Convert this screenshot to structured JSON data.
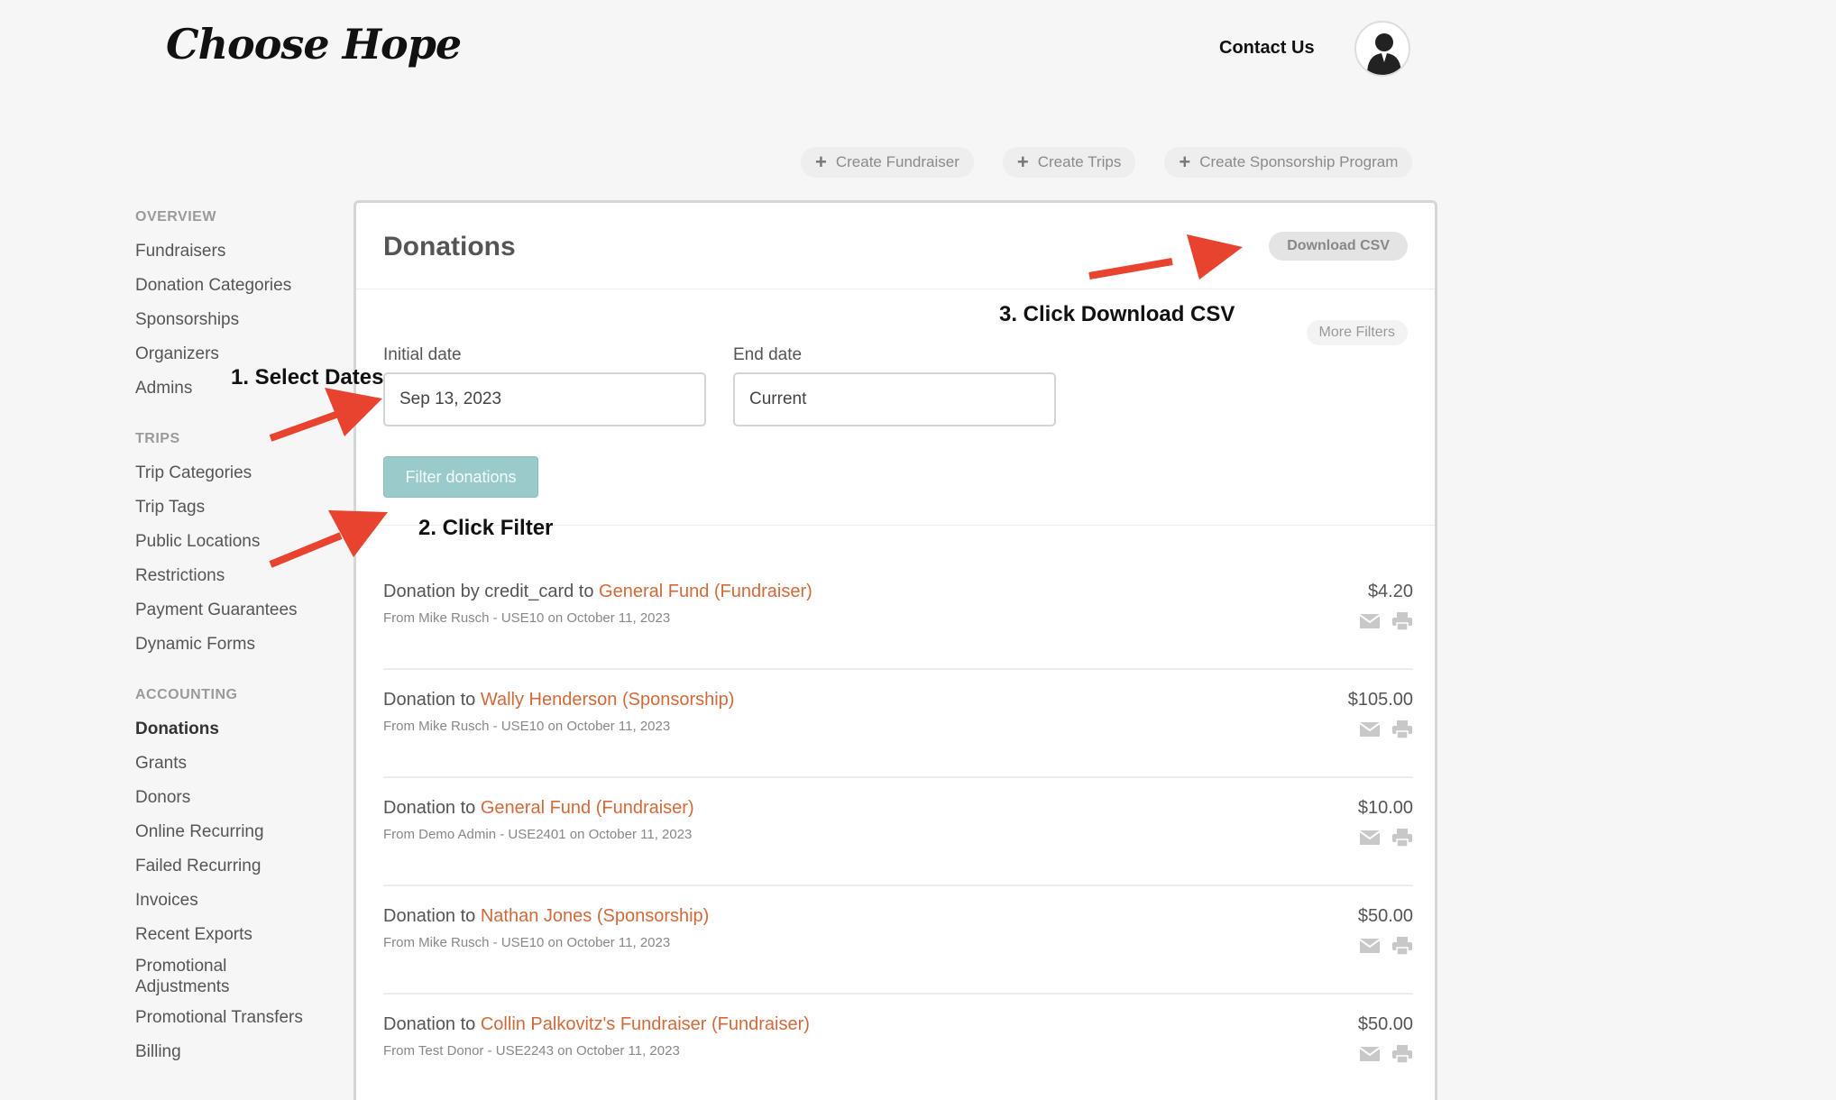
{
  "header": {
    "logo_text": "Choose Hope",
    "contact_label": "Contact Us",
    "avatar_icon": "user-icon"
  },
  "create_actions": [
    {
      "label": "Create Fundraiser",
      "icon": "plus-icon"
    },
    {
      "label": "Create Trips",
      "icon": "plus-icon"
    },
    {
      "label": "Create Sponsorship Program",
      "icon": "plus-icon"
    }
  ],
  "sidebar": {
    "sections": [
      {
        "heading": "OVERVIEW",
        "items": [
          "Fundraisers",
          "Donation Categories",
          "Sponsorships",
          "Organizers",
          "Admins"
        ]
      },
      {
        "heading": "TRIPS",
        "items": [
          "Trip Categories",
          "Trip Tags",
          "Public Locations",
          "Restrictions",
          "Payment Guarantees",
          "Dynamic Forms"
        ]
      },
      {
        "heading": "ACCOUNTING",
        "items": [
          "Donations",
          "Grants",
          "Donors",
          "Online Recurring",
          "Failed Recurring",
          "Invoices",
          "Recent Exports",
          "Promotional Adjustments",
          "Promotional Transfers",
          "Billing"
        ]
      }
    ],
    "active_item": "Donations"
  },
  "panel": {
    "title": "Donations",
    "download_label": "Download CSV",
    "more_filters_label": "More Filters",
    "initial_date_label": "Initial date",
    "initial_date_value": "Sep 13, 2023",
    "end_date_label": "End date",
    "end_date_value": "Current",
    "filter_label": "Filter donations"
  },
  "donations": [
    {
      "prefix": "Donation by credit_card to ",
      "link": "General Fund (Fundraiser)",
      "meta": "From Mike Rusch - USE10 on October 11, 2023",
      "amount": "$4.20"
    },
    {
      "prefix": "Donation to ",
      "link": "Wally Henderson (Sponsorship)",
      "meta": "From Mike Rusch - USE10 on October 11, 2023",
      "amount": "$105.00"
    },
    {
      "prefix": "Donation to ",
      "link": "General Fund (Fundraiser)",
      "meta": "From Demo Admin - USE2401 on October 11, 2023",
      "amount": "$10.00"
    },
    {
      "prefix": "Donation to ",
      "link": "Nathan Jones (Sponsorship)",
      "meta": "From Mike Rusch - USE10 on October 11, 2023",
      "amount": "$50.00"
    },
    {
      "prefix": "Donation to ",
      "link": "Collin Palkovitz's Fundraiser (Fundraiser)",
      "meta": "From Test Donor - USE2243 on October 11, 2023",
      "amount": "$50.00"
    }
  ],
  "annotations": {
    "step1": "1. Select Dates",
    "step2": "2. Click Filter",
    "step3": "3. Click Download CSV"
  },
  "colors": {
    "link": "#d06a3a",
    "filter_button": "#9acaca",
    "annotation_arrow": "#e8432e"
  }
}
